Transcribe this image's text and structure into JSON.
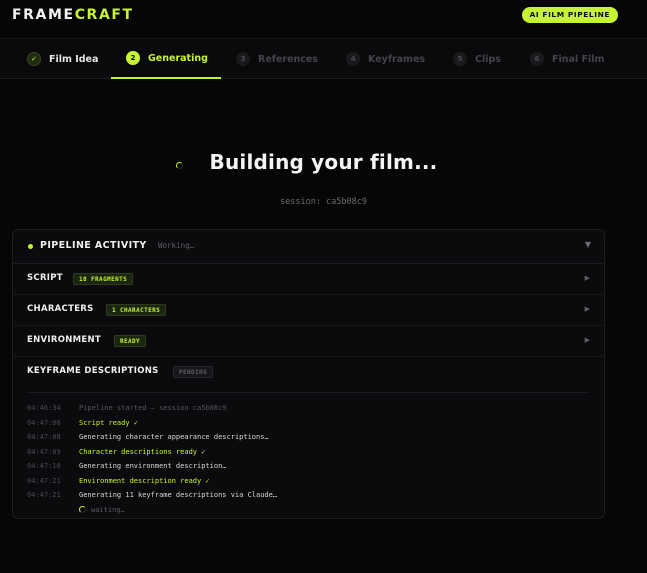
{
  "app": {
    "logo_part1": "FRAME",
    "logo_part2": "CRAFT",
    "badge": "AI FILM PIPELINE",
    "accent_color": "#c6f432"
  },
  "steps": [
    {
      "num": "✓",
      "label": "Film Idea",
      "state": "done"
    },
    {
      "num": "2",
      "label": "Generating",
      "state": "active"
    },
    {
      "num": "3",
      "label": "References",
      "state": "todo"
    },
    {
      "num": "4",
      "label": "Keyframes",
      "state": "todo"
    },
    {
      "num": "5",
      "label": "Clips",
      "state": "todo"
    },
    {
      "num": "6",
      "label": "Final Film",
      "state": "todo"
    }
  ],
  "main": {
    "title": "Building your film...",
    "session": "session: ca5b08c9"
  },
  "panel": {
    "title": "PIPELINE ACTIVITY",
    "status": "Working…",
    "caret": "▼",
    "rows": [
      {
        "label": "SCRIPT",
        "badge": "18 FRAGMENTS",
        "badge_style": "green",
        "arrow": "▶"
      },
      {
        "label": "CHARACTERS",
        "badge": "1 CHARACTERS",
        "badge_style": "green",
        "arrow": "▶"
      },
      {
        "label": "ENVIRONMENT",
        "badge": "READY",
        "badge_style": "green",
        "arrow": "▶"
      },
      {
        "label": "KEYFRAME DESCRIPTIONS",
        "badge": "PENDING",
        "badge_style": "gray",
        "arrow": ""
      }
    ],
    "log": [
      {
        "time": "04:46:34",
        "msg": "Pipeline started — session ca5b08c9",
        "style": "dim"
      },
      {
        "time": "04:47:08",
        "msg": "Script ready ✓",
        "style": "ok"
      },
      {
        "time": "04:47:08",
        "msg": "Generating character appearance descriptions…",
        "style": "normal"
      },
      {
        "time": "04:47:09",
        "msg": "Character descriptions ready ✓",
        "style": "ok"
      },
      {
        "time": "04:47:10",
        "msg": "Generating environment description…",
        "style": "normal"
      },
      {
        "time": "04:47:21",
        "msg": "Environment description ready ✓",
        "style": "ok"
      },
      {
        "time": "04:47:21",
        "msg": "Generating 11 keyframe descriptions via Claude…",
        "style": "normal"
      }
    ],
    "waiting": "waiting…"
  }
}
